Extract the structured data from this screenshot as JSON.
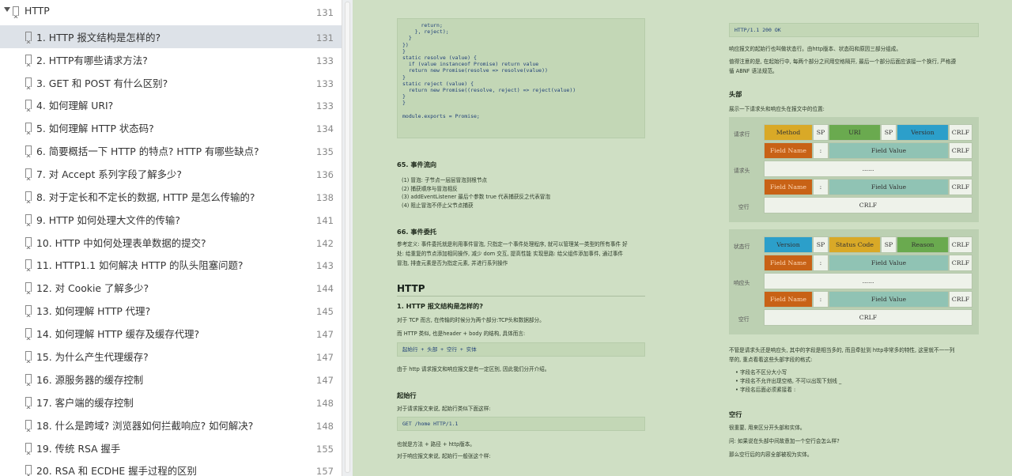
{
  "sidebar": {
    "root": {
      "label": "HTTP",
      "page": "131"
    },
    "items": [
      {
        "label": "1. HTTP 报文结构是怎样的?",
        "page": "131"
      },
      {
        "label": "2. HTTP有哪些请求方法?",
        "page": "133"
      },
      {
        "label": "3. GET 和 POST 有什么区别?",
        "page": "133"
      },
      {
        "label": "4. 如何理解 URI?",
        "page": "133"
      },
      {
        "label": "5. 如何理解 HTTP 状态码?",
        "page": "134"
      },
      {
        "label": "6. 简要概括一下 HTTP 的特点? HTTP 有哪些缺点?",
        "page": "135"
      },
      {
        "label": "7. 对 Accept 系列字段了解多少?",
        "page": "136"
      },
      {
        "label": "8. 对于定长和不定长的数据, HTTP 是怎么传输的?",
        "page": "138"
      },
      {
        "label": "9. HTTP 如何处理大文件的传输?",
        "page": "141"
      },
      {
        "label": "10. HTTP 中如何处理表单数据的提交?",
        "page": "142"
      },
      {
        "label": "11. HTTP1.1 如何解决 HTTP 的队头阻塞问题?",
        "page": "143"
      },
      {
        "label": "12.  对 Cookie 了解多少?",
        "page": "144"
      },
      {
        "label": "13. 如何理解 HTTP 代理?",
        "page": "145"
      },
      {
        "label": "14. 如何理解 HTTP 缓存及缓存代理?",
        "page": "147"
      },
      {
        "label": "15. 为什么产生代理缓存?",
        "page": "147"
      },
      {
        "label": "16. 源服务器的缓存控制",
        "page": "147"
      },
      {
        "label": "17. 客户端的缓存控制",
        "page": "148"
      },
      {
        "label": "18. 什么是跨域? 浏览器如何拦截响应? 如何解决?",
        "page": "148"
      },
      {
        "label": "19. 传统 RSA 握手",
        "page": "155"
      },
      {
        "label": "20. RSA 和 ECDHE 握手过程的区别",
        "page": "157"
      }
    ]
  },
  "doc": {
    "left": {
      "code1_lines": [
        "      return;",
        "    }, reject);",
        "  }",
        "})",
        "}",
        "static resolve (value) {",
        "  if (value instanceof Promise) return value",
        "  return new Promise(resolve => resolve(value))",
        "}",
        "static reject (value) {",
        "  return new Promise((resolve, reject) => reject(value))",
        "}",
        "}",
        "",
        "module.exports = Promise;"
      ],
      "s65_title": "65. 事件流向",
      "s65_items": [
        "(1) 冒泡: 子节点一层层冒泡到根节点",
        "(2) 捕获顺序与冒泡相反",
        "(3) addEventListener 最后个参数 true 代表捕获反之代表冒泡",
        "(4) 阻止冒泡不停止父节点捕获"
      ],
      "s66_title": "66. 事件委托",
      "s66_p1": "参考定义: 事件委托就是利用事件冒泡, 只指定一个事件处理程序, 就可以管理某一类型的所有事件 好",
      "s66_p2": "处: 给重复的节点添加相同操作, 减少 dom 交互, 提高性能 实现思路: 给父组件添加事件, 通过事件",
      "s66_p3": "冒泡, 排查元素是否为指定元素, 并进行系列操作",
      "http_title": "HTTP",
      "q1_title": "1. HTTP 报文结构是怎样的?",
      "q1_p1": "对于 TCP 而言, 在传输的时候分为两个部分:TCP头和数据部分。",
      "q1_p2": "而 HTTP 类似, 也是header + body 的结构, 具体而言:",
      "code2": "起始行 + 头部 + 空行 + 实体",
      "q1_p3": "由于 http 请求报文和响应报文是有一定区别, 因此我们分开介绍。",
      "start_title": "起始行",
      "start_p1": "对于请求报文来说, 起始行类似下面这样:",
      "code3": "GET /home HTTP/1.1",
      "start_p2": "也就是方法 + 路径 + http版本。",
      "start_p3": "对于响应报文来说, 起始行一般张这个样:"
    },
    "right": {
      "code4": "HTTP/1.1 200 OK",
      "p1": "响应报文的起始行也叫做状态行。由http版本、状态码和原因三部分组成。",
      "p2": "值得注意的是, 在起始行中, 每两个部分之间用空格隔开, 最后一个部分后面应该接一个换行, 严格遵",
      "p3": "循 ABNF 语法规范。",
      "head_title": "头部",
      "head_p": "展示一下请求头和响应头在报文中的位置:",
      "req": {
        "row_labels": [
          "请求行",
          "请求头",
          "空行"
        ],
        "method": "Method",
        "sp": "SP",
        "uri": "URI",
        "version": "Version",
        "crlf": "CRLF",
        "field_name": "Field Name",
        "colon": ":",
        "field_value": "Field Value",
        "dots": "......"
      },
      "res": {
        "row_labels": [
          "状态行",
          "响应头",
          "空行"
        ],
        "version": "Version",
        "sp": "SP",
        "status_code": "Status Code",
        "reason": "Reason",
        "crlf": "CRLF",
        "field_name": "Field Name",
        "colon": ":",
        "field_value": "Field Value",
        "dots": "......"
      },
      "p4": "不管是请求头还是响应头, 其中的字段是相当多的, 而且牵扯到 http非常多的特性, 这里就不一一列",
      "p5": "举的, 重点看看这些头部字段的格式:",
      "bullets": [
        "字段名不区分大小写",
        "字段名不允许出现空格, 不可以出现下划线 _",
        "字段名后面必须紧接着 :"
      ],
      "empty_title": "空行",
      "empty_p1": "很重要, 用来区分开头部和实体。",
      "empty_p2": "问: 如果说在头部中间故意加一个空行会怎么样?",
      "empty_p3": "那么空行后的内容全部被视为实体。"
    }
  },
  "colors": {
    "doc_bg": "#cfdfc4",
    "sidebar_active": "#dde2e8"
  }
}
